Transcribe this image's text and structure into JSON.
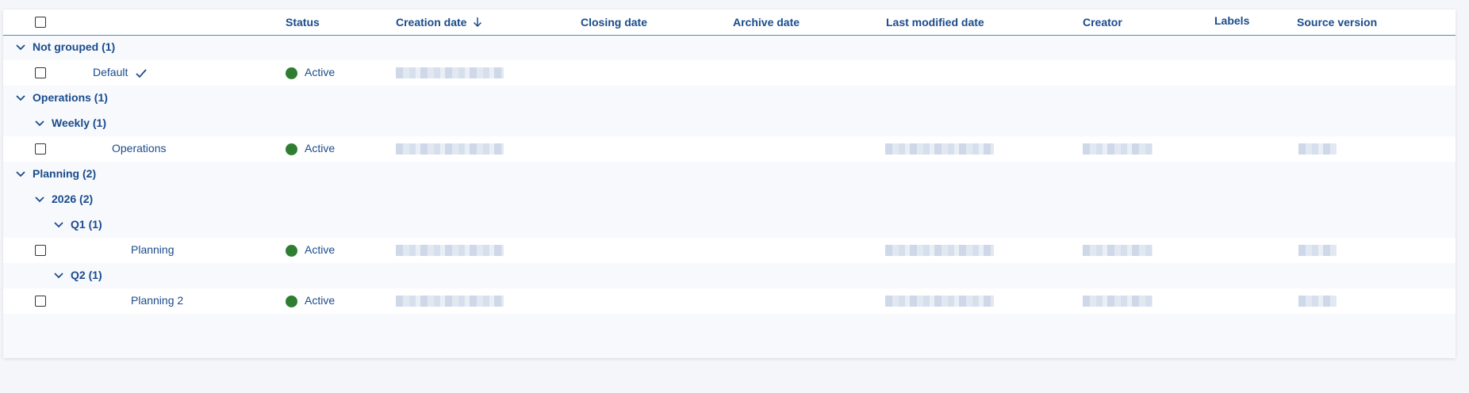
{
  "columns": {
    "status": "Status",
    "creation_date": "Creation date",
    "closing_date": "Closing date",
    "archive_date": "Archive date",
    "last_modified_date": "Last modified date",
    "creator": "Creator",
    "labels": "Labels",
    "source_version": "Source version"
  },
  "sort": {
    "column": "creation_date",
    "direction": "descending",
    "icon": "arrow-down-icon"
  },
  "groups": {
    "not_grouped": "Not grouped (1)",
    "operations": "Operations (1)",
    "weekly": "Weekly (1)",
    "planning": "Planning (2)",
    "year_2026": "2026 (2)",
    "q1": "Q1 (1)",
    "q2": "Q2 (1)"
  },
  "items": [
    {
      "name": "Default",
      "status": "Active",
      "is_default": true
    },
    {
      "name": "Operations",
      "status": "Active"
    },
    {
      "name": "Planning",
      "status": "Active"
    },
    {
      "name": "Planning 2",
      "status": "Active"
    }
  ],
  "colors": {
    "accent": "#1a4b8c",
    "active": "#2e7d32",
    "header_border": "#4c8cb8"
  }
}
